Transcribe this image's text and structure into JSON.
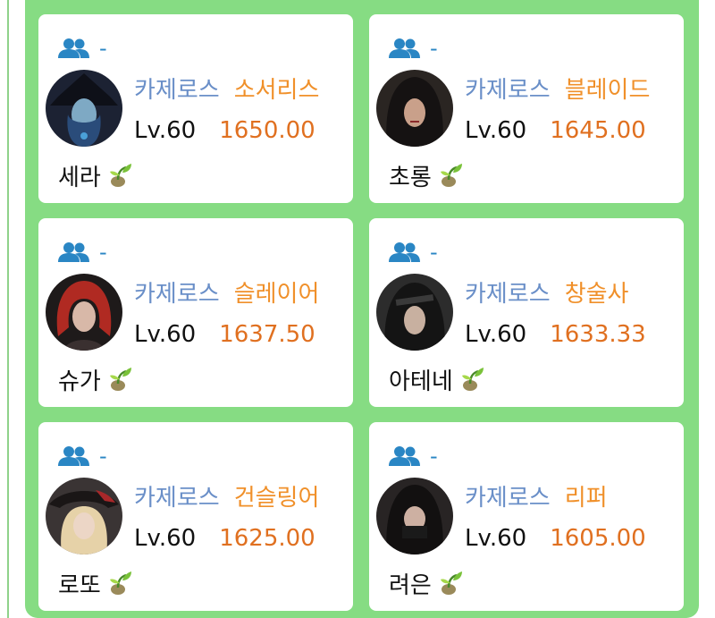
{
  "colors": {
    "panel_bg": "#86dc83",
    "card_bg": "#ffffff",
    "server_text": "#6a8fc8",
    "class_text": "#f0902a",
    "score_text": "#e07020",
    "group_icon": "#2a86c4"
  },
  "cards": [
    {
      "group": "-",
      "group_icon": "group-users-icon",
      "server": "카제로스",
      "class": "소서리스",
      "level": "Lv.60",
      "score": "1650.00",
      "name": "세라",
      "badge_icon": "sprout-icon"
    },
    {
      "group": "-",
      "group_icon": "group-users-icon",
      "server": "카제로스",
      "class": "블레이드",
      "level": "Lv.60",
      "score": "1645.00",
      "name": "초롱",
      "badge_icon": "sprout-icon"
    },
    {
      "group": "-",
      "group_icon": "group-users-icon",
      "server": "카제로스",
      "class": "슬레이어",
      "level": "Lv.60",
      "score": "1637.50",
      "name": "슈가",
      "badge_icon": "sprout-icon"
    },
    {
      "group": "-",
      "group_icon": "group-users-icon",
      "server": "카제로스",
      "class": "창술사",
      "level": "Lv.60",
      "score": "1633.33",
      "name": "아테네",
      "badge_icon": "sprout-icon"
    },
    {
      "group": "-",
      "group_icon": "group-users-icon",
      "server": "카제로스",
      "class": "건슬링어",
      "level": "Lv.60",
      "score": "1625.00",
      "name": "로또",
      "badge_icon": "sprout-icon"
    },
    {
      "group": "-",
      "group_icon": "group-users-icon",
      "server": "카제로스",
      "class": "리퍼",
      "level": "Lv.60",
      "score": "1605.00",
      "name": "려은",
      "badge_icon": "sprout-icon"
    }
  ]
}
